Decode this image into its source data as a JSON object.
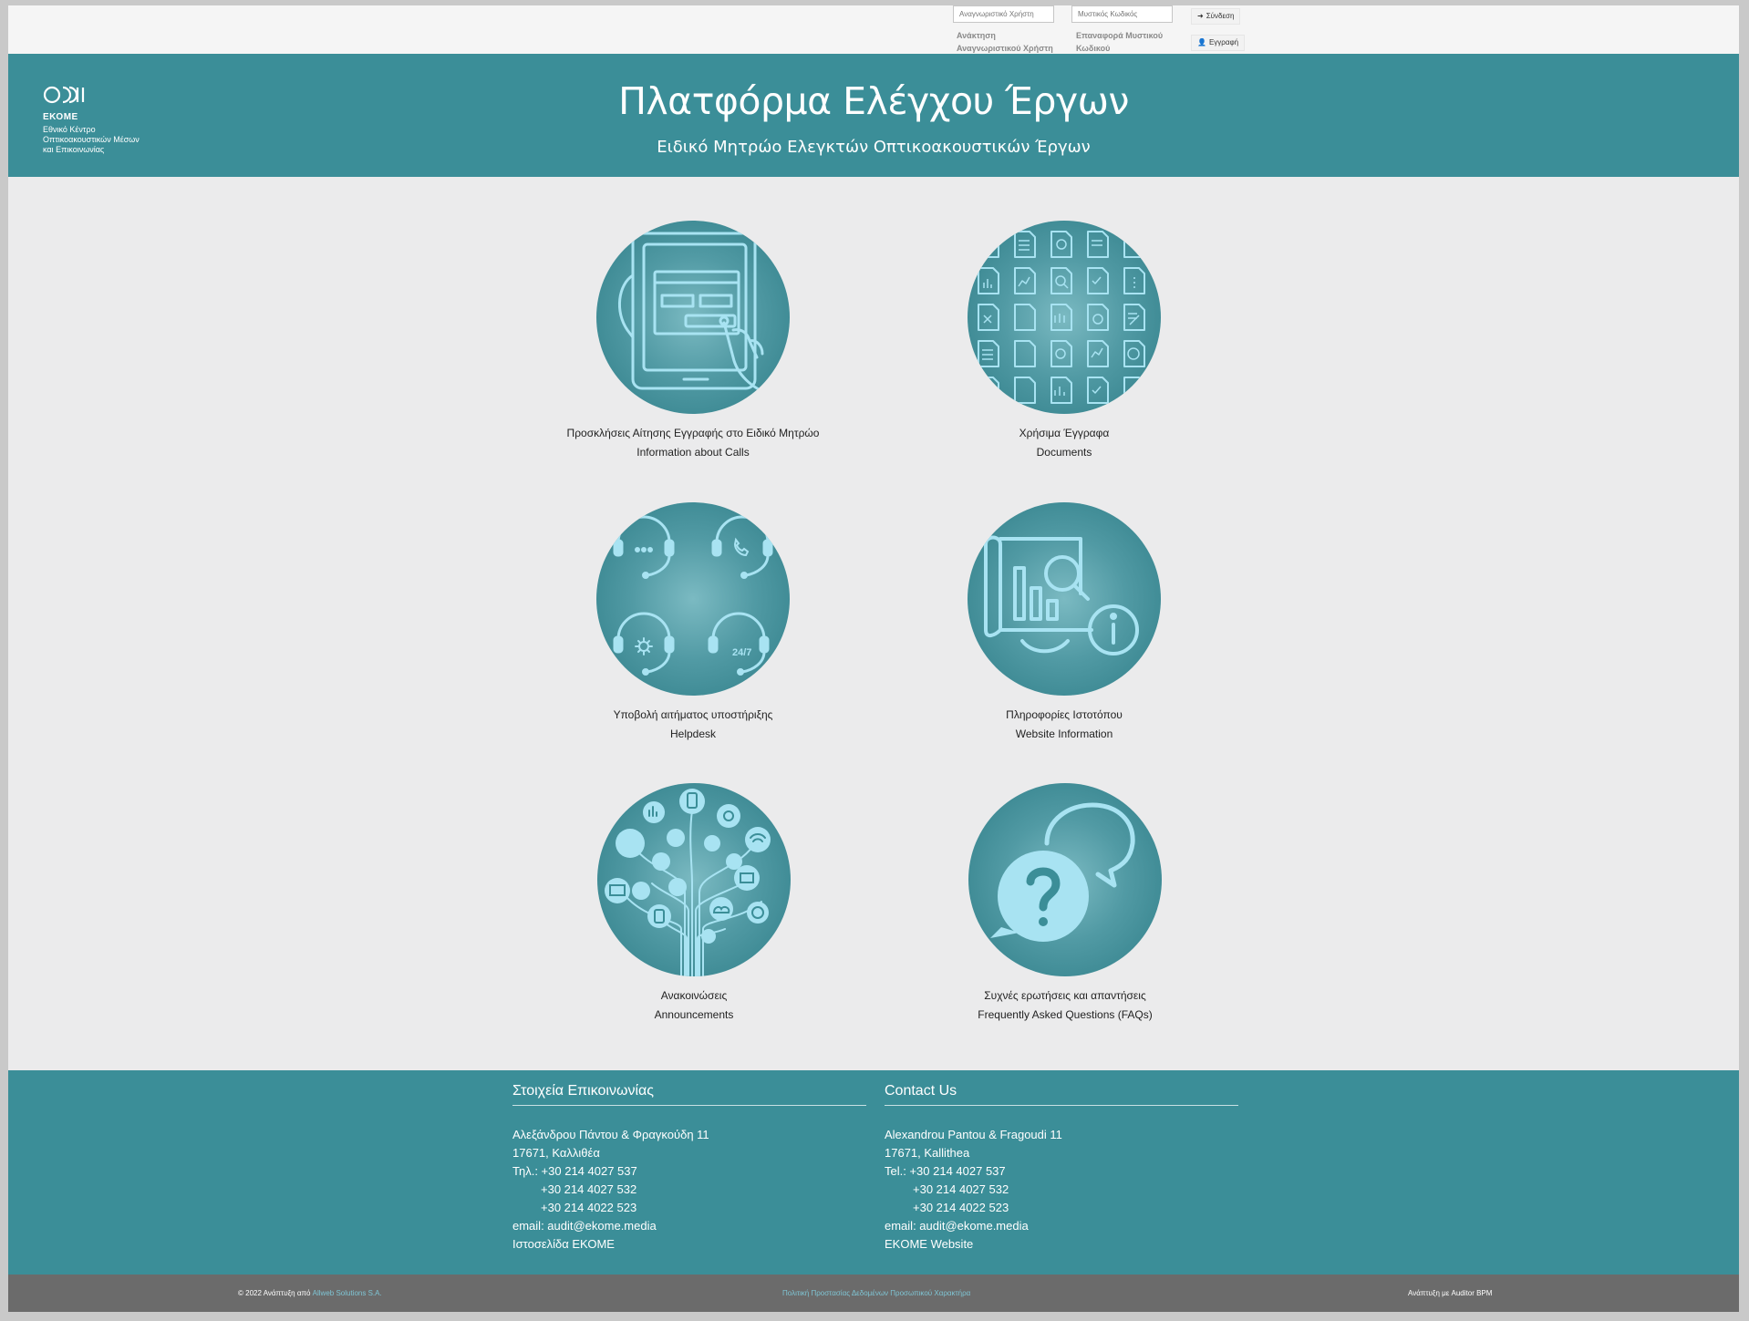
{
  "topbar": {
    "username_placeholder": "Αναγνωριστικό Χρήστη",
    "password_placeholder": "Μυστικός Κωδικός",
    "login_label": "Σύνδεση",
    "register_label": "Εγγραφή",
    "recover_username_line1": "Ανάκτηση",
    "recover_username_line2": "Αναγνωριστικού Χρήστη",
    "reset_password_line1": "Επαναφορά Μυστικού",
    "reset_password_line2": "Κωδικού"
  },
  "header": {
    "org_name": "ΕΚΟΜΕ",
    "org_sub1": "Εθνικό Κέντρο",
    "org_sub2": "Οπτικοακουστικών Μέσων",
    "org_sub3": "και Επικοινωνίας",
    "title": "Πλατφόρμα Ελέγχου Έργων",
    "subtitle": "Ειδικό Μητρώο Ελεγκτών Οπτικοακουστικών Έργων"
  },
  "tiles": [
    {
      "el": "Προσκλήσεις Αίτησης Εγγραφής στο Ειδικό Μητρώο",
      "en": "Information about Calls",
      "icon": "tablet-touch-icon"
    },
    {
      "el": "Χρήσιμα Έγγραφα",
      "en": "Documents",
      "icon": "documents-grid-icon"
    },
    {
      "el": "Υποβολή αιτήματος υποστήριξης",
      "en": "Helpdesk",
      "icon": "headset-support-icon",
      "badge": "24/7"
    },
    {
      "el": "Πληροφορίες Ιστοτόπου",
      "en": "Website Information",
      "icon": "report-info-icon"
    },
    {
      "el": "Ανακοινώσεις",
      "en": "Announcements",
      "icon": "network-tree-icon"
    },
    {
      "el": "Συχνές ερωτήσεις και απαντήσεις",
      "en": "Frequently Asked Questions (FAQs)",
      "icon": "question-bubble-icon"
    }
  ],
  "footer": {
    "el": {
      "heading": "Στοιχεία Επικοινωνίας",
      "address1": "Αλεξάνδρου Πάντου & Φραγκούδη 11",
      "address2": "17671, Καλλιθέα",
      "phone_label": "Τηλ.: +30 214 4027 537",
      "phone2": "+30 214 4027 532",
      "phone3": "+30 214 4022 523",
      "email": "email: audit@ekome.media",
      "website": "Ιστοσελίδα ΕΚΟΜΕ"
    },
    "en": {
      "heading": "Contact Us",
      "address1": "Alexandrou Pantou & Fragoudi 11",
      "address2": "17671, Kallithea",
      "phone_label": "Tel.: +30 214 4027 537",
      "phone2": "+30 214 4027 532",
      "phone3": "+30 214 4022 523",
      "email": "email: audit@ekome.media",
      "website": "EKOME Website"
    }
  },
  "bottombar": {
    "copyright": "© 2022 Ανάπτυξη από",
    "developer": "Allweb Solutions S.A.",
    "privacy": "Πολιτική Προστασίας Δεδομένων Προσωπικού Χαρακτήρα",
    "powered": "Ανάπτυξη με Auditor BPM"
  },
  "colors": {
    "brand_teal": "#3b8e98",
    "icon_line": "#a8e3f2",
    "bottom_bar": "#6b6b6b",
    "link": "#7fc5d4"
  }
}
